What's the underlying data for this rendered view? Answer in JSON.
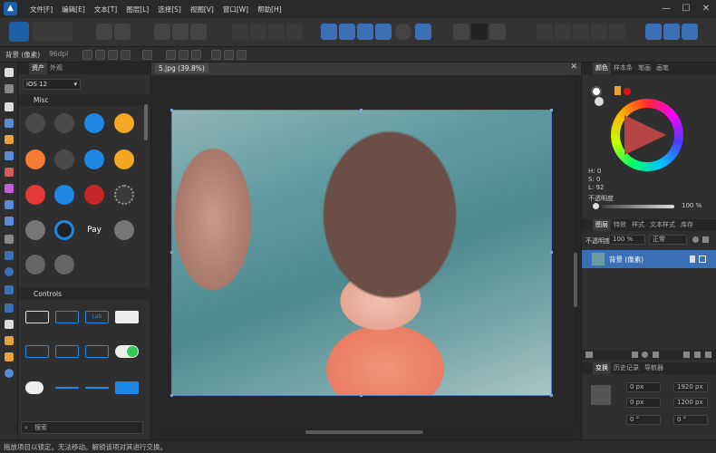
{
  "menu": [
    "文件[F]",
    "编辑[E]",
    "文本[T]",
    "图层[L]",
    "选择[S]",
    "视图[V]",
    "窗口[W]",
    "帮助[H]"
  ],
  "window_controls": {
    "minimize": "—",
    "maximize": "☐",
    "close": "✕"
  },
  "context_bar": {
    "layer_name": "背景 (像素)",
    "dpi": "96dpi"
  },
  "assets_panel": {
    "tabs": [
      "资产",
      "外观"
    ],
    "category": "iOS 12",
    "sections": [
      "Misc",
      "Controls"
    ],
    "search_placeholder": "搜索",
    "control_sample_text": "Lab"
  },
  "document": {
    "tab_title": "5.jpg (39.8%)"
  },
  "color_panel": {
    "tabs": [
      "颜色",
      "样本条",
      "笔画",
      "画笔"
    ],
    "h_label": "H: 0",
    "s_label": "S: 0",
    "l_label": "L: 92",
    "opacity_label": "不透明度",
    "opacity_value": "100 %",
    "colors": {
      "primary_fill": "#ffffff",
      "accent": "#e2141b",
      "hue": "#b74545"
    }
  },
  "layers_panel": {
    "tabs": [
      "图层",
      "特效",
      "样式",
      "文本样式",
      "库存"
    ],
    "opacity_label": "不透明度:",
    "opacity_value": "100 %",
    "blend_mode": "正常",
    "layer_name": "背景 (像素)"
  },
  "transform_panel": {
    "tabs": [
      "变换",
      "历史记录",
      "导航器"
    ],
    "x": "0 px",
    "y": "0 px",
    "w": "1920 px",
    "h": "1200 px",
    "r": "0 °",
    "s": "0 °"
  },
  "status_bar": {
    "message": "拖放项目以锁定。无法移动。解锁该项对其进行交换。"
  }
}
